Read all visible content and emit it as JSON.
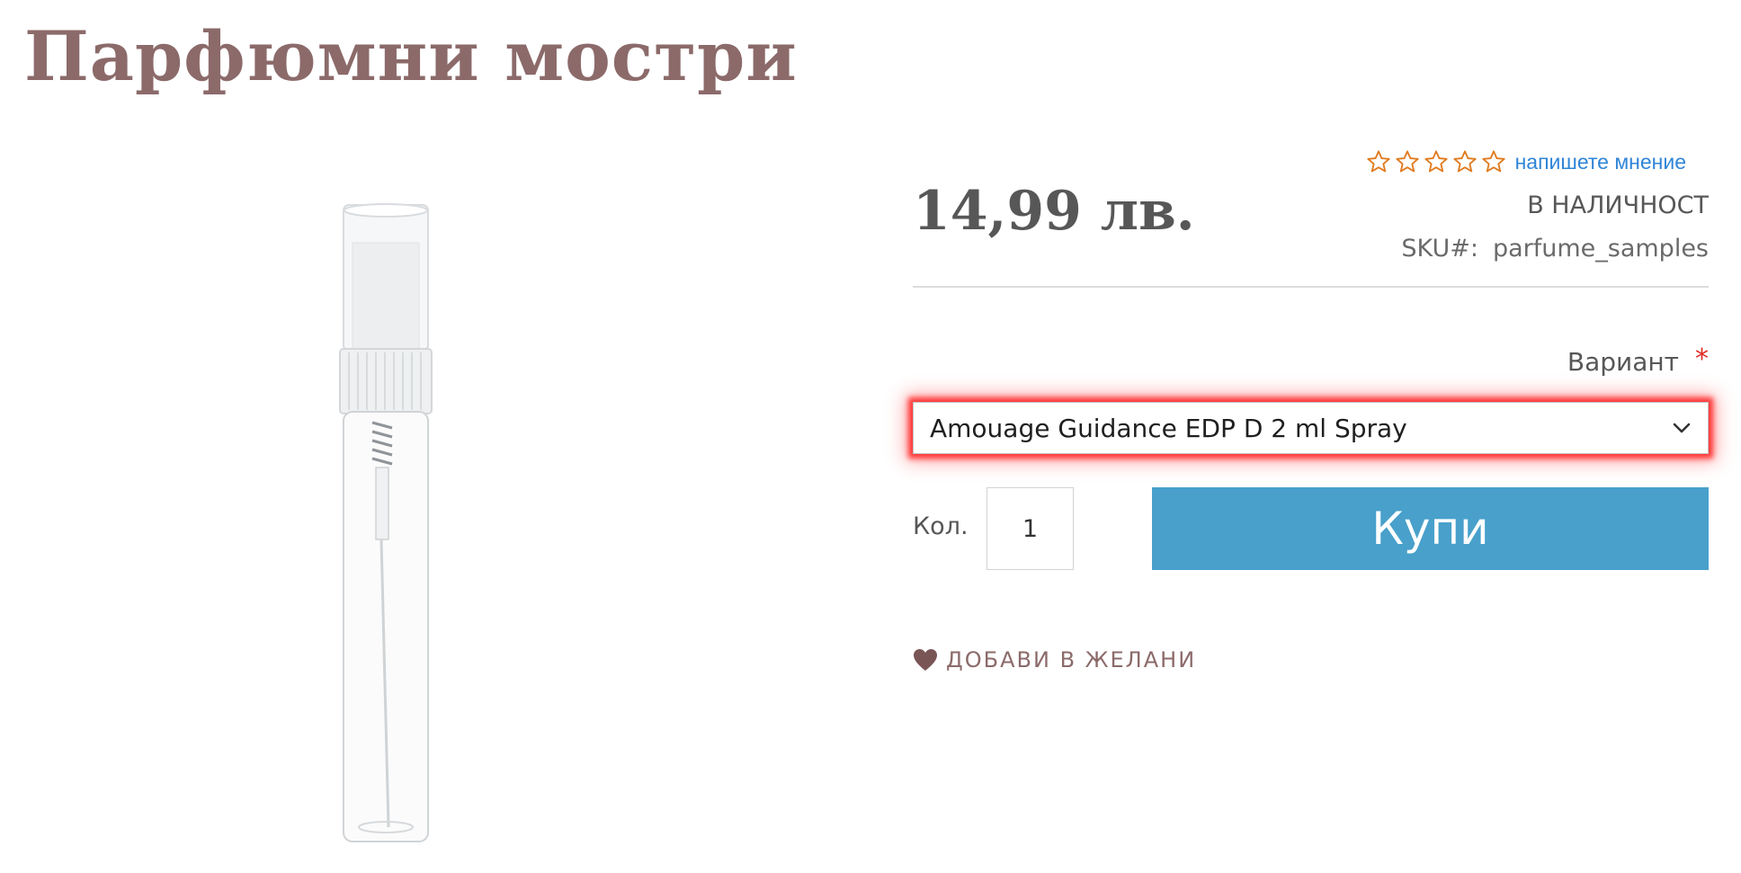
{
  "page": {
    "title": "Парфюмни мостри"
  },
  "product": {
    "image_alt": "parfume sample spray vial",
    "price": "14,99 лв.",
    "stock_status": "В НАЛИЧНОСТ",
    "sku_label": "SKU#:",
    "sku_value": "parfume_samples"
  },
  "rating": {
    "stars_filled": 0,
    "stars_total": 5,
    "review_link": "напишете мнение"
  },
  "variant": {
    "label": "Вариант",
    "required_mark": "*",
    "selected": "Amouage Guidance EDP D 2 ml Spray"
  },
  "purchase": {
    "qty_label": "Кол.",
    "qty_value": "1",
    "buy_label": "Купи"
  },
  "wishlist": {
    "label": "ДОБАВИ В ЖЕЛАНИ"
  },
  "colors": {
    "title": "#8c6a6a",
    "star": "#e07b1f",
    "link": "#2f85d7",
    "buy_button": "#48a0cb",
    "required": "#e02b27",
    "highlight": "#ff1e1e"
  },
  "icons": {
    "rating": "star-outline-icon",
    "select": "chevron-down-icon",
    "wishlist": "heart-icon"
  }
}
